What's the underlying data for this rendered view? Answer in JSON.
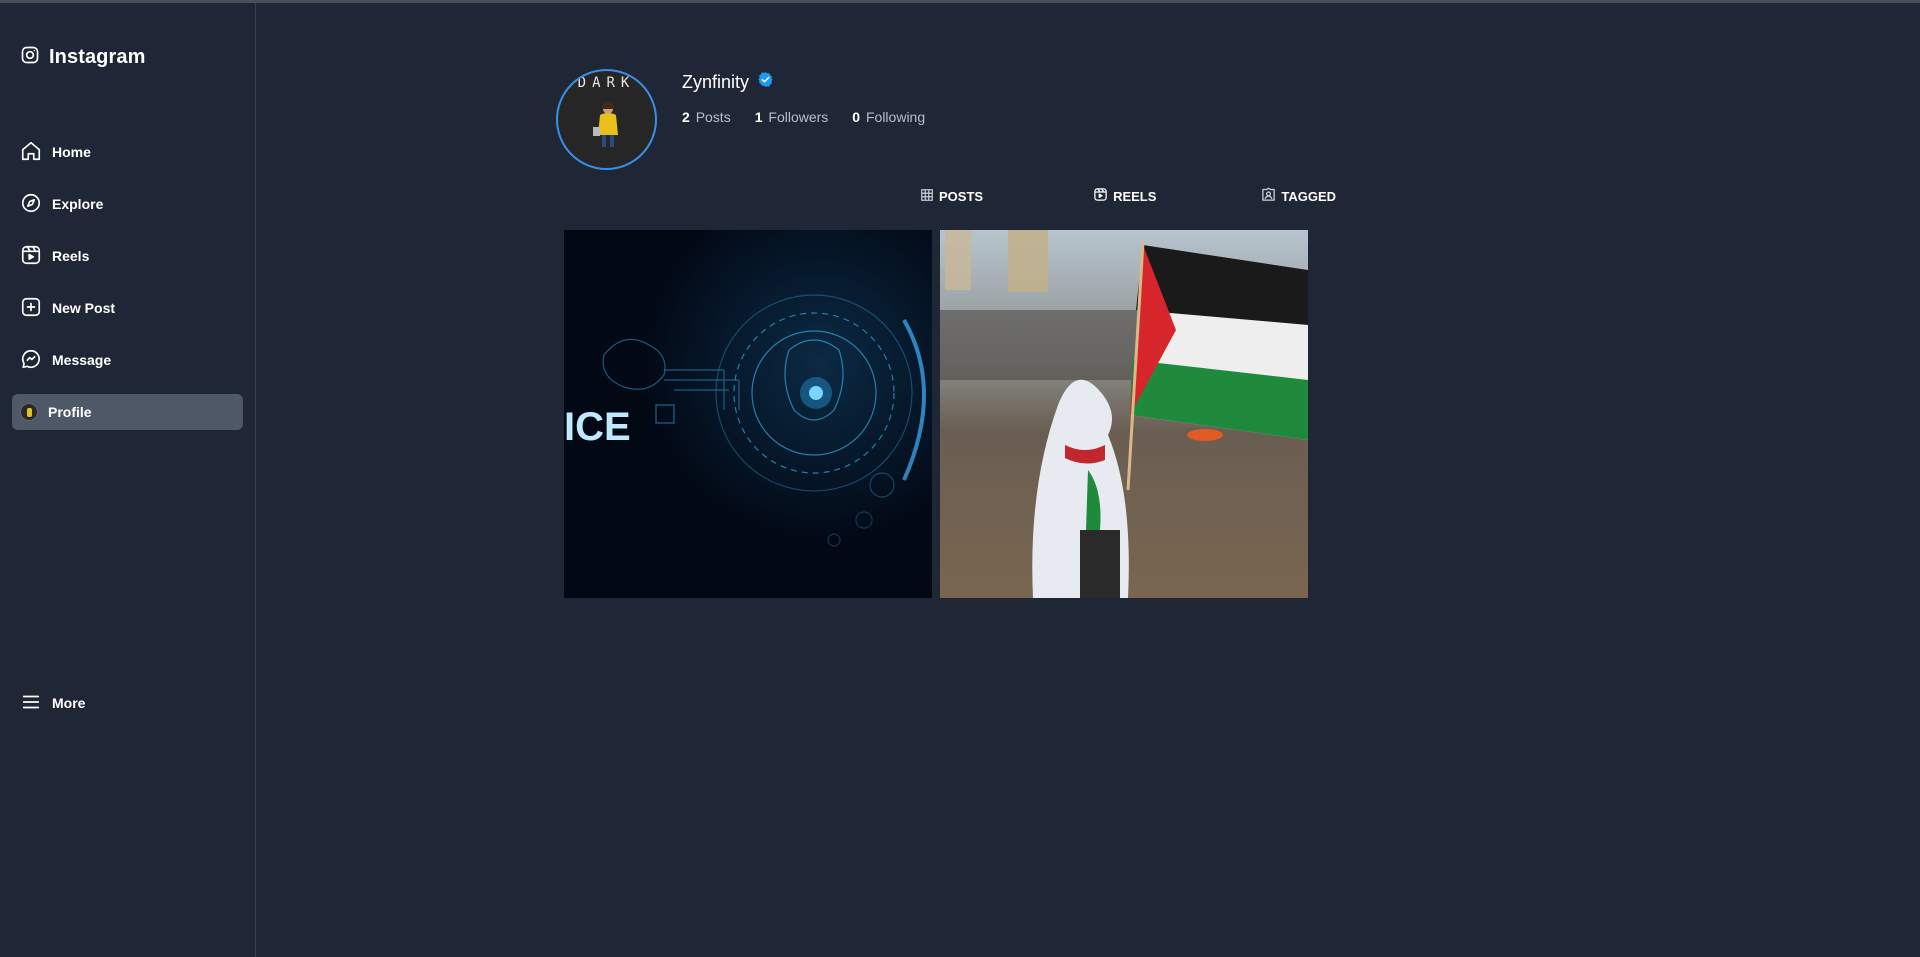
{
  "app": {
    "title": "Instagram",
    "logo_icon": "instagram-icon"
  },
  "sidebar": {
    "items": [
      {
        "label": "Home",
        "icon": "home-icon",
        "active": false
      },
      {
        "label": "Explore",
        "icon": "compass-icon",
        "active": false
      },
      {
        "label": "Reels",
        "icon": "reels-icon",
        "active": false
      },
      {
        "label": "New Post",
        "icon": "plus-square-icon",
        "active": false
      },
      {
        "label": "Message",
        "icon": "messenger-icon",
        "active": false
      },
      {
        "label": "Profile",
        "icon": "avatar-icon",
        "active": true
      }
    ],
    "more_label": "More"
  },
  "profile": {
    "username": "Zynfinity",
    "verified": true,
    "avatar_text": "DARK",
    "stats": {
      "posts": {
        "count": "2",
        "label": "Posts"
      },
      "followers": {
        "count": "1",
        "label": "Followers"
      },
      "following": {
        "count": "0",
        "label": "Following"
      }
    }
  },
  "tabs": [
    {
      "label": "POSTS",
      "icon": "grid-icon"
    },
    {
      "label": "REELS",
      "icon": "reels-icon"
    },
    {
      "label": "TAGGED",
      "icon": "tagged-icon"
    }
  ],
  "posts": [
    {
      "name": "post-ai-artwork",
      "overlay_text": "ICE"
    },
    {
      "name": "post-flag-photo"
    }
  ],
  "colors": {
    "background": "#1f2736",
    "active_item": "#4f5866",
    "verified_blue": "#1d9bf0",
    "avatar_ring": "#3b8ee8"
  }
}
